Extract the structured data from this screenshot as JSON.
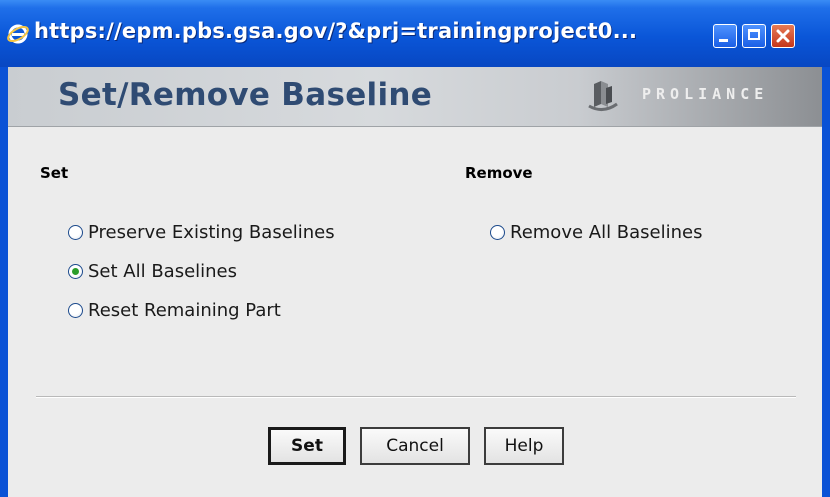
{
  "window": {
    "title": "https://epm.pbs.gsa.gov/?&prj=trainingproject0...",
    "minimize_icon": "minimize-icon",
    "maximize_icon": "maximize-icon",
    "close_icon": "close-icon",
    "titlebar_color": "#0a56d8",
    "close_color": "#d9532f"
  },
  "header": {
    "title": "Set/Remove Baseline",
    "logo_text": "PROLIANCE",
    "title_color": "#2f4b73"
  },
  "set_section": {
    "label": "Set",
    "options": [
      {
        "label": "Preserve Existing Baselines",
        "checked": false
      },
      {
        "label": "Set All Baselines",
        "checked": true
      },
      {
        "label": "Reset Remaining Part",
        "checked": false
      }
    ]
  },
  "remove_section": {
    "label": "Remove",
    "options": [
      {
        "label": "Remove All Baselines",
        "checked": false
      }
    ]
  },
  "buttons": {
    "set": "Set",
    "cancel": "Cancel",
    "help": "Help"
  }
}
